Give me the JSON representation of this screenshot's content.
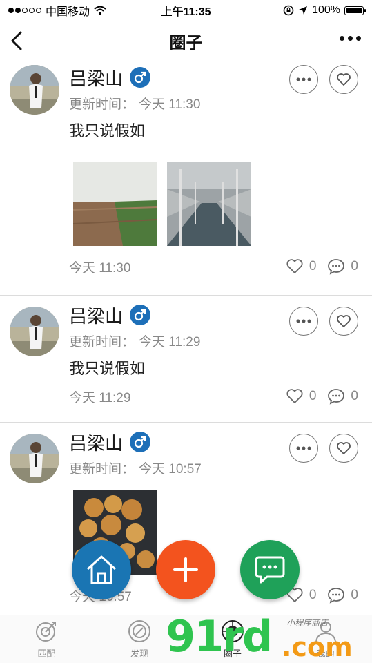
{
  "status": {
    "carrier": "中国移动",
    "time": "上午11:35",
    "battery": "100%"
  },
  "nav": {
    "title": "圈子"
  },
  "posts": [
    {
      "name": "吕梁山",
      "update_label": "更新时间：",
      "update_time": "今天 11:30",
      "text": "我只说假如",
      "footer_time": "今天 11:30",
      "likes": "0",
      "comments": "0",
      "photos": [
        "field",
        "subway"
      ]
    },
    {
      "name": "吕梁山",
      "update_label": "更新时间：",
      "update_time": "今天 11:29",
      "text": "我只说假如",
      "footer_time": "今天 11:29",
      "likes": "0",
      "comments": "0",
      "photos": []
    },
    {
      "name": "吕梁山",
      "update_label": "更新时间：",
      "update_time": "今天 10:57",
      "text": "",
      "footer_time": "今天 10:57",
      "likes": "0",
      "comments": "0",
      "photos": [
        "food"
      ]
    }
  ],
  "tabs": [
    {
      "label": "匹配",
      "icon": "target-icon"
    },
    {
      "label": "发现",
      "icon": "compass-icon"
    },
    {
      "label": "圈子",
      "icon": "circle-icon"
    },
    {
      "label": "我的",
      "icon": "user-icon"
    }
  ],
  "fabs": {
    "home": "home-icon",
    "add": "plus-icon",
    "chat": "chat-bubble-icon"
  },
  "watermark": {
    "main": "91rd",
    "suffix": ".com",
    "small": "小程序商店"
  },
  "colors": {
    "gender_badge": "#1d6fb8",
    "fab_home": "#1a75b3",
    "fab_add": "#f3531e",
    "fab_chat": "#1fa159",
    "watermark_green": "#2fc44f",
    "watermark_orange": "#f39a16"
  }
}
